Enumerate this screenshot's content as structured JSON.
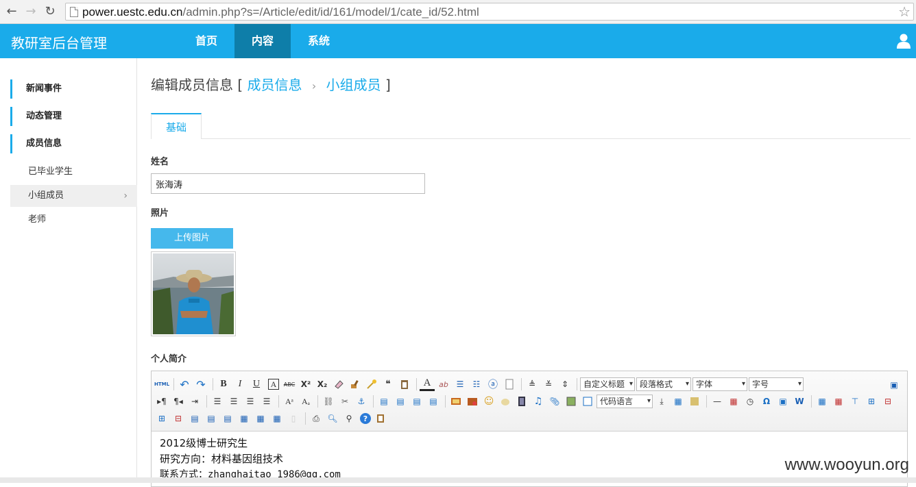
{
  "browser": {
    "url_host": "power.uestc.edu.cn",
    "url_path": "/admin.php?s=/Article/edit/id/161/model/1/cate_id/52.html"
  },
  "header": {
    "app_title": "教研室后台管理",
    "nav": [
      {
        "label": "首页",
        "active": false
      },
      {
        "label": "内容",
        "active": true
      },
      {
        "label": "系统",
        "active": false
      }
    ]
  },
  "sidebar": {
    "groups": [
      "新闻事件",
      "动态管理",
      "成员信息"
    ],
    "subitems": [
      "已毕业学生",
      "小组成员",
      "老师"
    ],
    "active_subitem": "小组成员"
  },
  "page": {
    "title": "编辑成员信息",
    "bracket_open": "[",
    "crumb1": "成员信息",
    "crumb_sep": "›",
    "crumb2": "小组成员",
    "bracket_close": "]",
    "tab": "基础"
  },
  "form": {
    "name_label": "姓名",
    "name_value": "张海涛",
    "photo_label": "照片",
    "upload_label": "上传图片",
    "bio_label": "个人简介"
  },
  "editor": {
    "selects": {
      "custom_heading": "自定义标题",
      "paragraph": "段落格式",
      "font": "字体",
      "size": "字号",
      "code_lang": "代码语言"
    },
    "html_btn": "HTML",
    "lines": [
      "2012级博士研究生",
      "研究方向：材料基因组技术",
      "联系方式：zhanghaitao_1986@qq.com"
    ]
  },
  "watermark": "www.wooyun.org"
}
